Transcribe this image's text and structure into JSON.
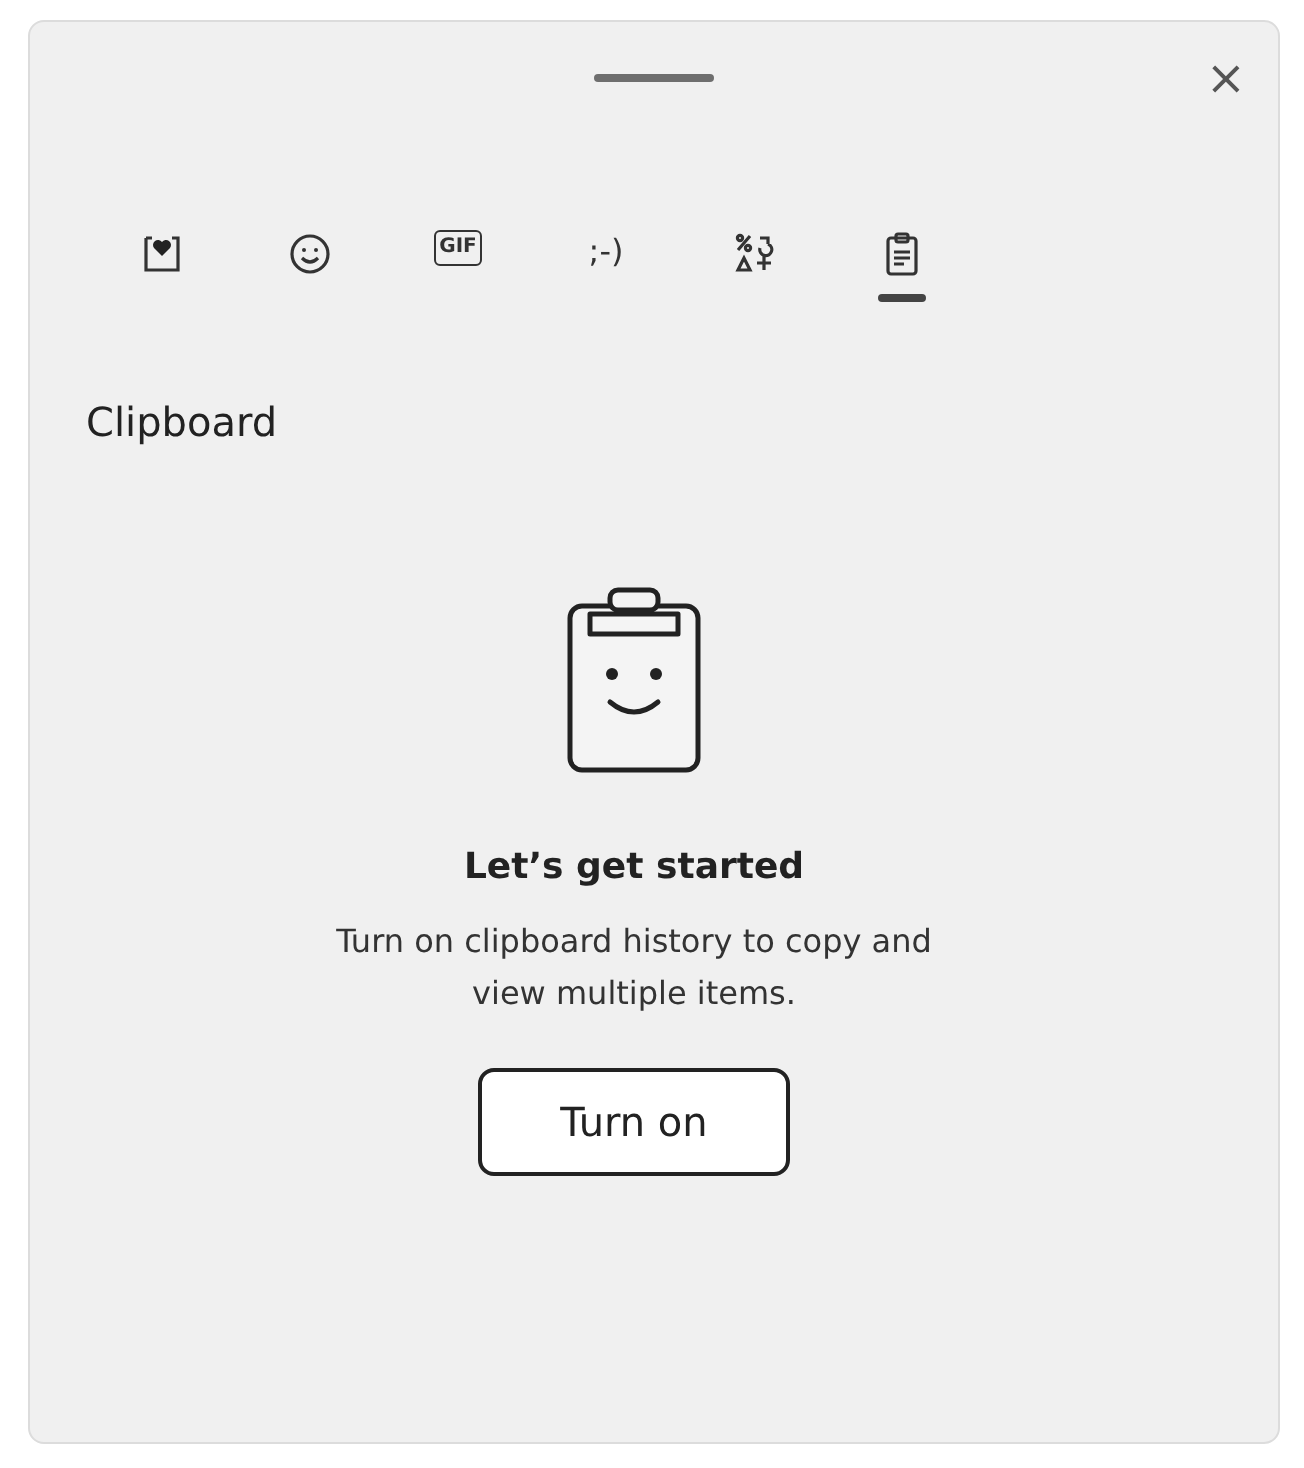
{
  "close_label": "×",
  "tabs": [
    {
      "kind": "favorites",
      "selected": false
    },
    {
      "kind": "emoji",
      "selected": false
    },
    {
      "kind": "gif",
      "label": "GIF",
      "selected": false
    },
    {
      "kind": "kaomoji",
      "label": ";-)",
      "selected": false
    },
    {
      "kind": "symbols",
      "selected": false
    },
    {
      "kind": "clipboard",
      "selected": true
    }
  ],
  "section_title": "Clipboard",
  "empty_state": {
    "title": "Let’s get started",
    "message": "Turn on clipboard history to copy and view multiple items.",
    "button": "Turn on"
  }
}
